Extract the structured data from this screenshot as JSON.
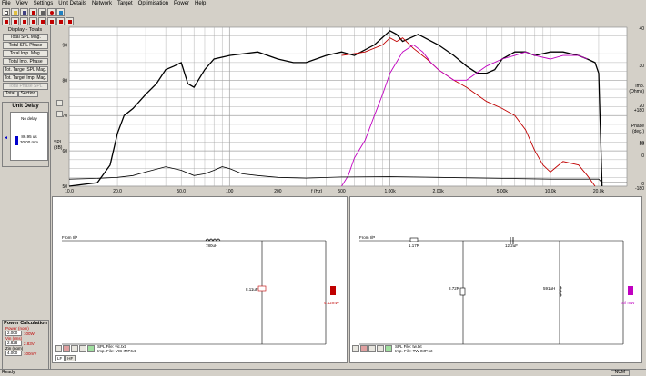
{
  "menu": [
    "File",
    "View",
    "Settings",
    "Unit Details",
    "Network",
    "Target",
    "Optimisation",
    "Power",
    "Help"
  ],
  "left_panel": {
    "title": "Display - Totals",
    "buttons": [
      "Total SPL Mag.",
      "Total SPL Phase",
      "Total Imp. Mag.",
      "Total Imp. Phase",
      "Tot. Target SPL Mag.",
      "Tot. Target Imp. Mag.",
      "Total Phase SPL"
    ],
    "tabs": [
      "Total",
      "Section"
    ]
  },
  "unit_delay": {
    "title": "Unit Delay",
    "label": "No delay",
    "value_time": "86.95 us",
    "value_dist": "30.00 mm"
  },
  "power_calc": {
    "title": "Power Calculation",
    "power_label": "Power (nom)",
    "power_value": "2.000",
    "power_unit": "100W",
    "vin_label": "Vin (rms)",
    "vin_value": "2.828",
    "vin_unit": "2.83V",
    "zin_label": "Zin (nom)",
    "zin_value": "4.000",
    "zin_unit": "100mV"
  },
  "chart": {
    "y_left_label": "SPL\n(dB)",
    "y_left_ticks": [
      "90",
      "80",
      "70",
      "60",
      "50"
    ],
    "x_ticks": [
      "10.0",
      "20.0",
      "50.0",
      "100",
      "200",
      "500",
      "1.00k",
      "2.00k",
      "5.00k",
      "10.0k",
      "20.0k"
    ],
    "x_unit": "f (Hz)",
    "right_imp_ticks": [
      "40",
      "30",
      "20",
      "10",
      "0"
    ],
    "right_imp_label": "Imp.\n(Ohms)",
    "right_phase_ticks": [
      "+180",
      "10",
      "0",
      "-180"
    ],
    "right_phase_label": "Phase\n(deg.)",
    "colors": {
      "spl": "#000000",
      "lf": "#c00000",
      "hf": "#c000c0",
      "imp": "#000000"
    }
  },
  "chart_data": {
    "type": "line",
    "xlabel": "f (Hz)",
    "ylabel": "SPL (dB)",
    "xlim": [
      10,
      30000
    ],
    "ylim": [
      50,
      95
    ],
    "x_scale": "log",
    "series": [
      {
        "x": [
          10,
          15,
          18,
          20,
          22,
          25,
          30,
          35,
          40,
          45,
          50,
          55,
          60,
          70,
          80,
          100,
          150,
          200,
          250,
          300,
          400,
          500,
          600,
          800,
          1000,
          1100,
          1200,
          1500,
          2000,
          2500,
          3000,
          3500,
          4000,
          4500,
          5000,
          6000,
          7000,
          8000,
          10000,
          12000,
          15000,
          17000,
          19000,
          20000,
          21000
        ],
        "y": [
          50,
          51,
          56,
          65,
          70,
          72,
          76,
          79,
          83,
          84,
          85,
          79,
          78,
          83,
          86,
          87,
          88,
          86,
          85,
          85,
          87,
          88,
          87,
          90,
          94,
          93,
          91,
          93,
          90,
          87,
          84,
          82,
          82,
          83,
          86,
          88,
          88,
          87,
          88,
          88,
          87,
          86,
          85,
          82,
          50
        ]
      },
      {
        "x": [
          500,
          700,
          900,
          1000,
          1100,
          1200,
          1400,
          1700,
          2000,
          2500,
          3000,
          4000,
          5000,
          6000,
          7000,
          8000,
          9000,
          10000,
          12000,
          15000,
          17000,
          19000
        ],
        "y": [
          87,
          88,
          90,
          92,
          91,
          92,
          89,
          86,
          83,
          80,
          78,
          74,
          72,
          70,
          66,
          60,
          56,
          54,
          57,
          56,
          53,
          50
        ]
      },
      {
        "x": [
          500,
          550,
          600,
          700,
          800,
          900,
          1000,
          1200,
          1400,
          1600,
          1800,
          2000,
          2500,
          3000,
          4000,
          5000,
          6000,
          7000,
          8000,
          10000,
          12000,
          15000,
          17000
        ],
        "y": [
          50,
          53,
          58,
          63,
          70,
          76,
          82,
          88,
          90,
          88,
          85,
          83,
          80,
          80,
          84,
          86,
          87,
          88,
          87,
          86,
          87,
          87,
          86
        ]
      },
      {
        "x": [
          10,
          15,
          20,
          25,
          30,
          40,
          50,
          60,
          70,
          80,
          90,
          100,
          120,
          150,
          200,
          300,
          500,
          1000,
          2000,
          5000,
          10000,
          20000,
          21000,
          30000
        ],
        "y": [
          52,
          52.2,
          52.5,
          53,
          54,
          55.5,
          54.5,
          53,
          53.5,
          54.5,
          55.5,
          55,
          53.5,
          53,
          52.5,
          52.3,
          52.6,
          52.7,
          52.5,
          52.2,
          52,
          52,
          51,
          51
        ]
      }
    ]
  },
  "schematic_lf": {
    "source_label": "From I/P",
    "inductor_value": "780uH",
    "capacitor_value": "8.11uF",
    "driver_label": "4.12mW",
    "spl_file": "SPL File: vic.txt",
    "imp_file": "Imp. File: VIC IMP.txt",
    "tabs": [
      "LF",
      "HF"
    ]
  },
  "schematic_hf": {
    "source_label": "From I/P",
    "resistor1_value": "1.17R",
    "capacitor_value": "12.2uF",
    "resistor2_value": "8.72R",
    "inductor_value": "591uH",
    "driver_label": "S/l mW",
    "spl_file": "SPL File: tw.txt",
    "imp_file": "Imp. File: TW IMP.txt"
  },
  "status": {
    "left": "Ready",
    "num": "NUM"
  }
}
